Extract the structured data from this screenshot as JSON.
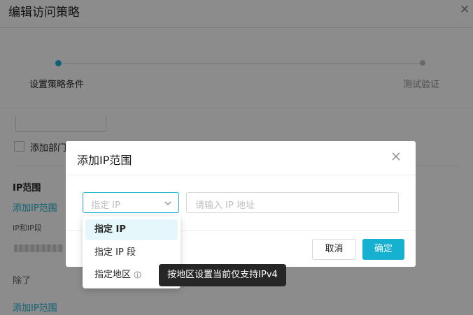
{
  "drawer": {
    "title": "编辑访问策略",
    "steps": [
      {
        "label": "设置策略条件",
        "state": "active"
      },
      {
        "label": "测试验证",
        "state": "pending"
      }
    ],
    "checkbox_label": "添加部门",
    "ip_section": {
      "title": "IP范围",
      "add_link": "添加IP范围",
      "subtitle": "IP和IP段",
      "except_label": "除了",
      "add_link_2": "添加IP范围"
    }
  },
  "modal": {
    "title": "添加IP范围",
    "select": {
      "placeholder": "指定 IP"
    },
    "ip_input": {
      "placeholder": "请输入 IP 地址"
    },
    "cancel_label": "取消",
    "confirm_label": "确定"
  },
  "dropdown": {
    "options": [
      {
        "label": "指定 IP",
        "highlighted": true
      },
      {
        "label": "指定 IP 段",
        "highlighted": false
      },
      {
        "label": "指定地区",
        "highlighted": false,
        "icon": "info-icon"
      }
    ]
  },
  "tooltip": {
    "text": "按地区设置当前仅支持IPv4"
  },
  "colors": {
    "accent": "#16b1d1",
    "tooltip_bg": "#262626",
    "highlight_bg": "#e6f7fb"
  }
}
